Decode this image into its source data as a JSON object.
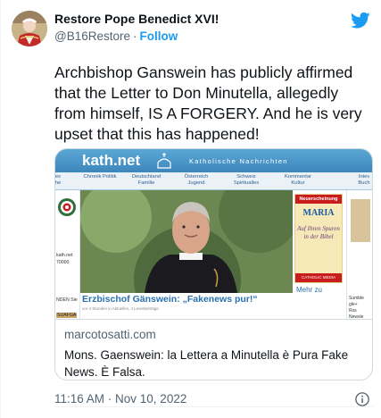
{
  "author": {
    "name": "Restore Pope Benedict XVI!",
    "handle": "@B16Restore",
    "separator": "·",
    "follow_label": "Follow"
  },
  "tweet": {
    "text": "Archbishop Ganswein has publicly affirmed that the Letter to Don Minutella, allegedly from himself, IS A FORGERY. And he is very upset that this has happened!",
    "timestamp": "11:16 AM · Nov 10, 2022"
  },
  "card": {
    "domain": "marcotosatti.com",
    "title": "Mons. Gaenswein: la Lettera a Minutella è Pura Fake News. È Falsa.",
    "screenshot": {
      "site_logo": "kath.net",
      "site_subtitle": "Katholische Nachrichten",
      "nav": [
        "Chronik Politik",
        "Deutschland Familie",
        "Österreich Jugend",
        "Schweiz Spiritualles",
        "Kommentar Kultur"
      ],
      "nav_left_partial": "elles irche",
      "nav_right_partial": "Intev Buch",
      "headline": "Erzbischof Gänswein: „Fakenews pur!“",
      "meta": "vor 4 Stunden in Aktuelles, 4 Leserbeiträge",
      "ad_new": "Neuerscheinung",
      "ad_title": "MARIA",
      "ad_sub": "Auf Ihren Spuren in der Bibel",
      "ad_publisher": "CATHOLIC MEDIA",
      "more": "Mehr zu",
      "left_snippets": [
        "kath.net",
        "70000",
        "NDEN Sie"
      ],
      "left_bottom": "SUAFGA",
      "right_snippets": [
        "Sumble",
        "gle+",
        "Rss",
        "Newsle"
      ]
    }
  },
  "colors": {
    "accent": "#1d9bf0",
    "text_primary": "#0f1419",
    "text_secondary": "#536471",
    "border": "#cfd9de"
  },
  "icons": {
    "logo": "twitter-bird-icon",
    "info": "info-icon"
  }
}
